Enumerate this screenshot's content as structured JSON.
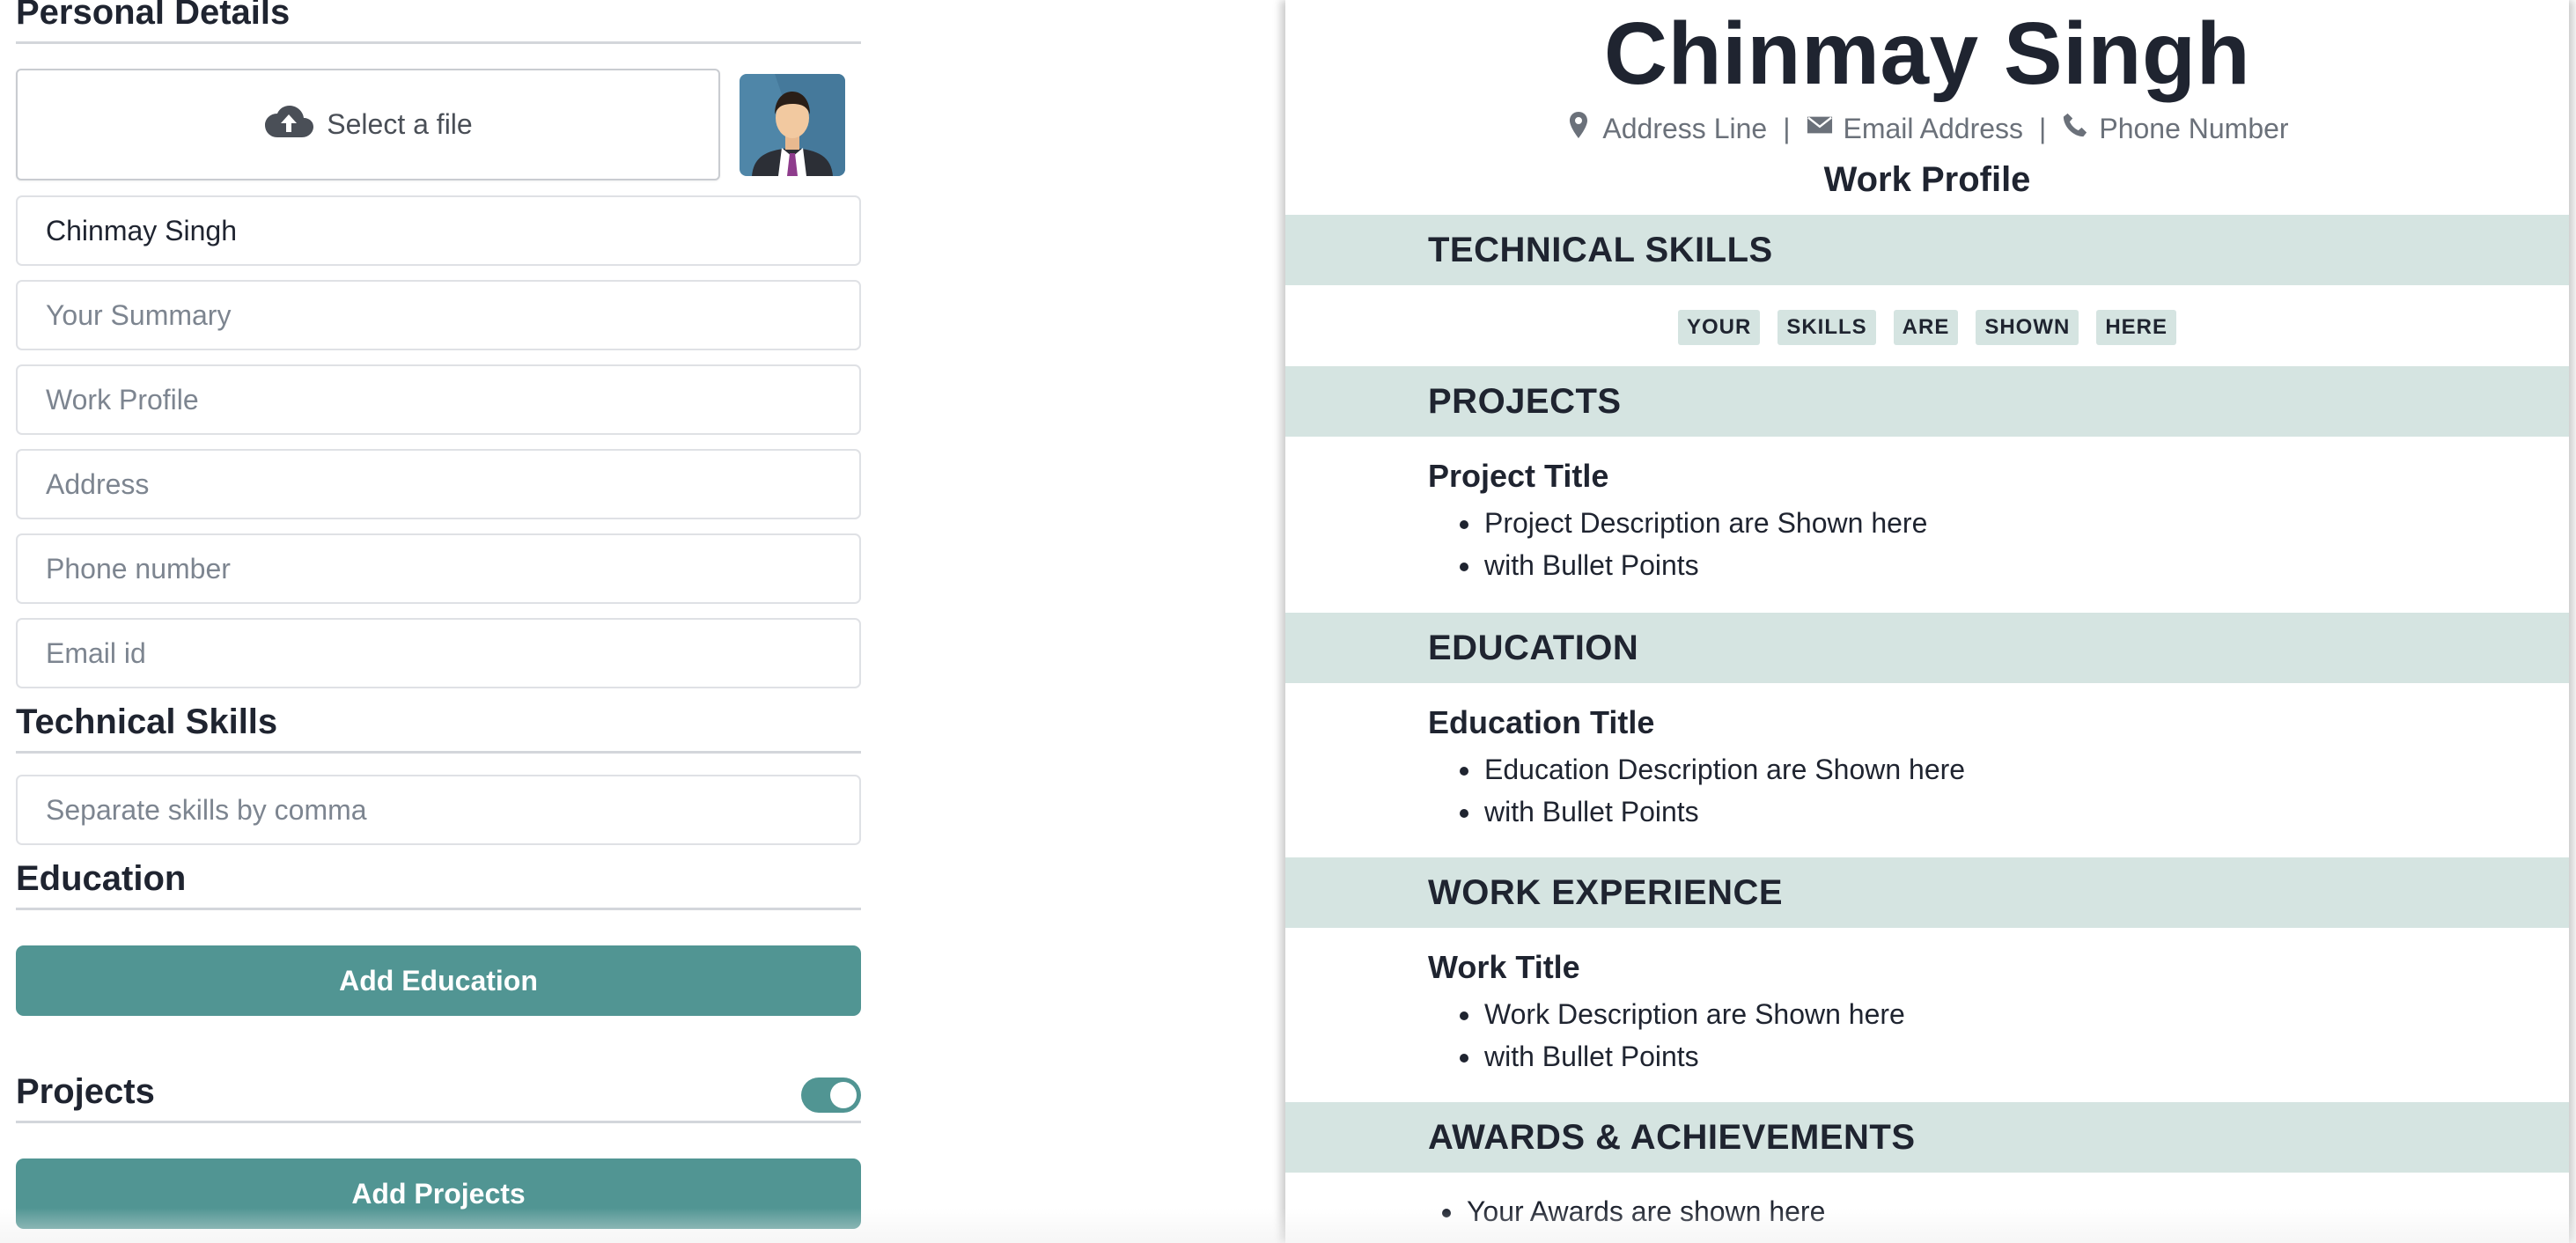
{
  "form": {
    "personal_heading": "Personal Details",
    "file_select_label": "Select a file",
    "name_value": "Chinmay Singh",
    "summary_placeholder": "Your Summary",
    "work_profile_placeholder": "Work Profile",
    "address_placeholder": "Address",
    "phone_placeholder": "Phone number",
    "email_placeholder": "Email id",
    "skills_heading": "Technical Skills",
    "skills_placeholder": "Separate skills by comma",
    "education_heading": "Education",
    "add_education_label": "Add Education",
    "projects_heading": "Projects",
    "projects_toggle_on": true,
    "add_projects_label": "Add Projects"
  },
  "resume": {
    "name": "Chinmay Singh",
    "address": "Address Line",
    "email": "Email Address",
    "phone": "Phone Number",
    "separator": "|",
    "work_profile": "Work Profile",
    "skills_heading": "TECHNICAL SKILLS",
    "skills": [
      "YOUR",
      "SKILLS",
      "ARE",
      "SHOWN",
      "HERE"
    ],
    "projects_heading": "PROJECTS",
    "project_title": "Project Title",
    "project_bullets": [
      "Project Description are Shown here",
      "with Bullet Points"
    ],
    "education_heading": "EDUCATION",
    "education_title": "Education Title",
    "education_bullets": [
      "Education Description are Shown here",
      "with Bullet Points"
    ],
    "work_heading": "WORK EXPERIENCE",
    "work_title": "Work Title",
    "work_bullets": [
      "Work Description are Shown here",
      "with Bullet Points"
    ],
    "awards_heading": "AWARDS & ACHIEVEMENTS",
    "awards_bullets": [
      "Your Awards are shown here"
    ]
  },
  "colors": {
    "accent": "#519593",
    "band": "#d5e4e1",
    "text": "#1f2430",
    "muted": "#6b717a"
  }
}
